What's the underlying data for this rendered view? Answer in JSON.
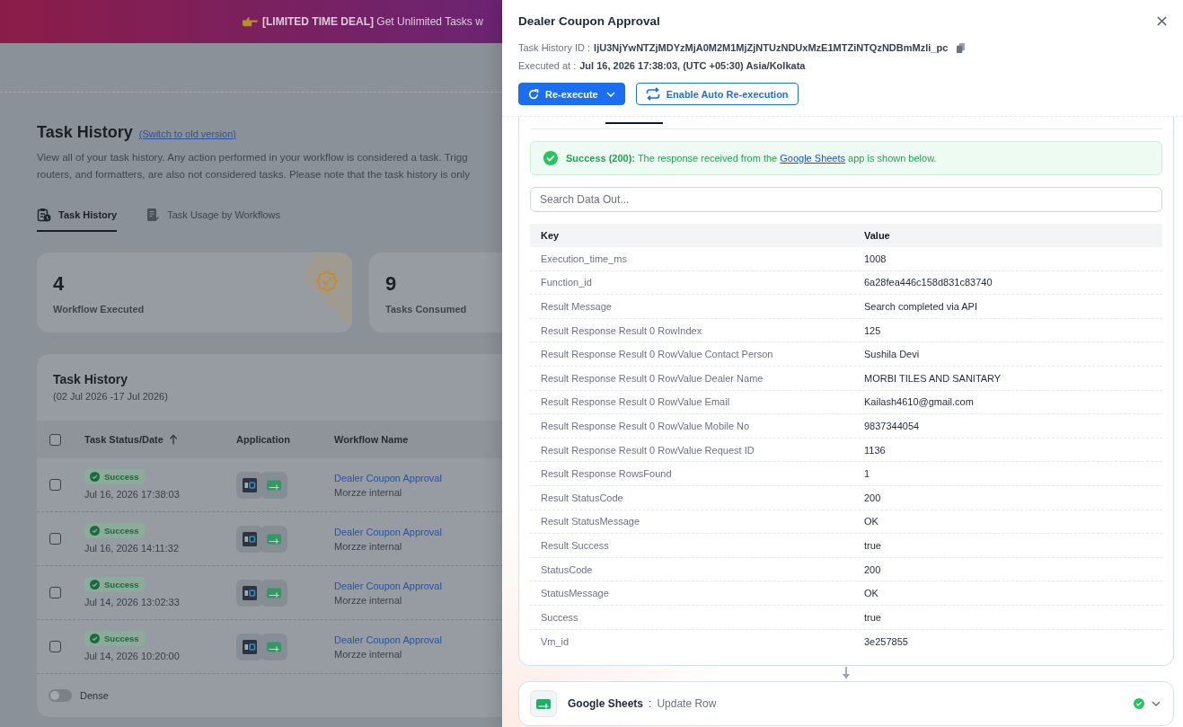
{
  "banner": {
    "text": "**[LIMITED TIME DEAL]** Get Unlimited Tasks w"
  },
  "page": {
    "title": "Task History",
    "switch_link": "(Switch to old version)",
    "description": [
      "View all of your task history. Any action performed in your workflow is considered a task. Trigg",
      "routers, and formatters, are also not considered tasks. Please note that the task history is only"
    ],
    "tabs": [
      {
        "kind": "history",
        "label": "Task History",
        "selected": true
      },
      {
        "kind": "usage",
        "label": "Task Usage by Workflows",
        "selected": false
      }
    ],
    "stats": [
      {
        "kind": "executed",
        "value": "4",
        "label": "Workflow Executed"
      },
      {
        "kind": "consumed",
        "value": "9",
        "label": "Tasks Consumed"
      }
    ],
    "table": {
      "title": "Task History",
      "range": "(02 Jul 2026 -17 Jul 2026)",
      "select_all": {
        "checked": false
      },
      "columns": [
        {
          "label": "Task Status/Date",
          "sorted": true
        },
        {
          "label": "Application",
          "sorted": false
        },
        {
          "label": "Workflow Name",
          "sorted": false
        }
      ],
      "rows": [
        {
          "checked": false,
          "status": "Success",
          "date": "Jul 16, 2026 17:38:03",
          "workflow": "Dealer Coupon Approval",
          "team": "Morzze internal"
        },
        {
          "checked": false,
          "status": "Success",
          "date": "Jul 16, 2026 14:11:32",
          "workflow": "Dealer Coupon Approval",
          "team": "Morzze internal"
        },
        {
          "checked": false,
          "status": "Success",
          "date": "Jul 14, 2026 13:02:33",
          "workflow": "Dealer Coupon Approval",
          "team": "Morzze internal"
        },
        {
          "checked": false,
          "status": "Success",
          "date": "Jul 14, 2026 10:20:00",
          "workflow": "Dealer Coupon Approval",
          "team": "Morzze internal"
        }
      ]
    },
    "dense": {
      "label": "Dense",
      "on": false
    }
  },
  "drawer": {
    "title": "Dealer Coupon Approval",
    "meta": [
      {
        "label": "Task History ID :",
        "value": "IjU3NjYwNTZjMDYzMjA0M2M1MjZjNTUzNDUxMzE1MTZiNTQzNDBmMzli_pc",
        "copyable": true
      },
      {
        "label": "Executed at :",
        "value": "Jul 16, 2026 17:38:03, (UTC +05:30) Asia/Kolkata",
        "copyable": false
      }
    ],
    "buttons": [
      {
        "kind": "primary",
        "label": "Re-execute"
      },
      {
        "kind": "outline",
        "label": "Enable Auto Re-execution"
      }
    ],
    "alert": {
      "status": "Success (200):",
      "before": "The response received from the",
      "link": "Google Sheets",
      "after": "app is shown below."
    },
    "search": {
      "placeholder": "Search Data Out..."
    },
    "data_table": {
      "columns": [
        "Key",
        "Value"
      ],
      "rows": [
        {
          "key": "Execution_time_ms",
          "value": "1008"
        },
        {
          "key": "Function_id",
          "value": "6a28fea446c158d831c83740"
        },
        {
          "key": "Result Message",
          "value": "Search completed via API"
        },
        {
          "key": "Result Response Result 0 RowIndex",
          "value": "125"
        },
        {
          "key": "Result Response Result 0 RowValue Contact Person",
          "value": "Sushila Devi"
        },
        {
          "key": "Result Response Result 0 RowValue Dealer Name",
          "value": "MORBI TILES AND SANITARY"
        },
        {
          "key": "Result Response Result 0 RowValue Email",
          "value": "Kailash4610@gmail.com"
        },
        {
          "key": "Result Response Result 0 RowValue Mobile No",
          "value": "9837344054"
        },
        {
          "key": "Result Response Result 0 RowValue Request ID",
          "value": "1136"
        },
        {
          "key": "Result Response RowsFound",
          "value": "1"
        },
        {
          "key": "Result StatusCode",
          "value": "200"
        },
        {
          "key": "Result StatusMessage",
          "value": "OK"
        },
        {
          "key": "Result Success",
          "value": "true"
        },
        {
          "key": "StatusCode",
          "value": "200"
        },
        {
          "key": "StatusMessage",
          "value": "OK"
        },
        {
          "key": "Success",
          "value": "true"
        },
        {
          "key": "Vm_id",
          "value": "3e257855"
        }
      ]
    },
    "next_step": {
      "app": "Google Sheets",
      "separator": ":",
      "action": "Update Row"
    }
  }
}
